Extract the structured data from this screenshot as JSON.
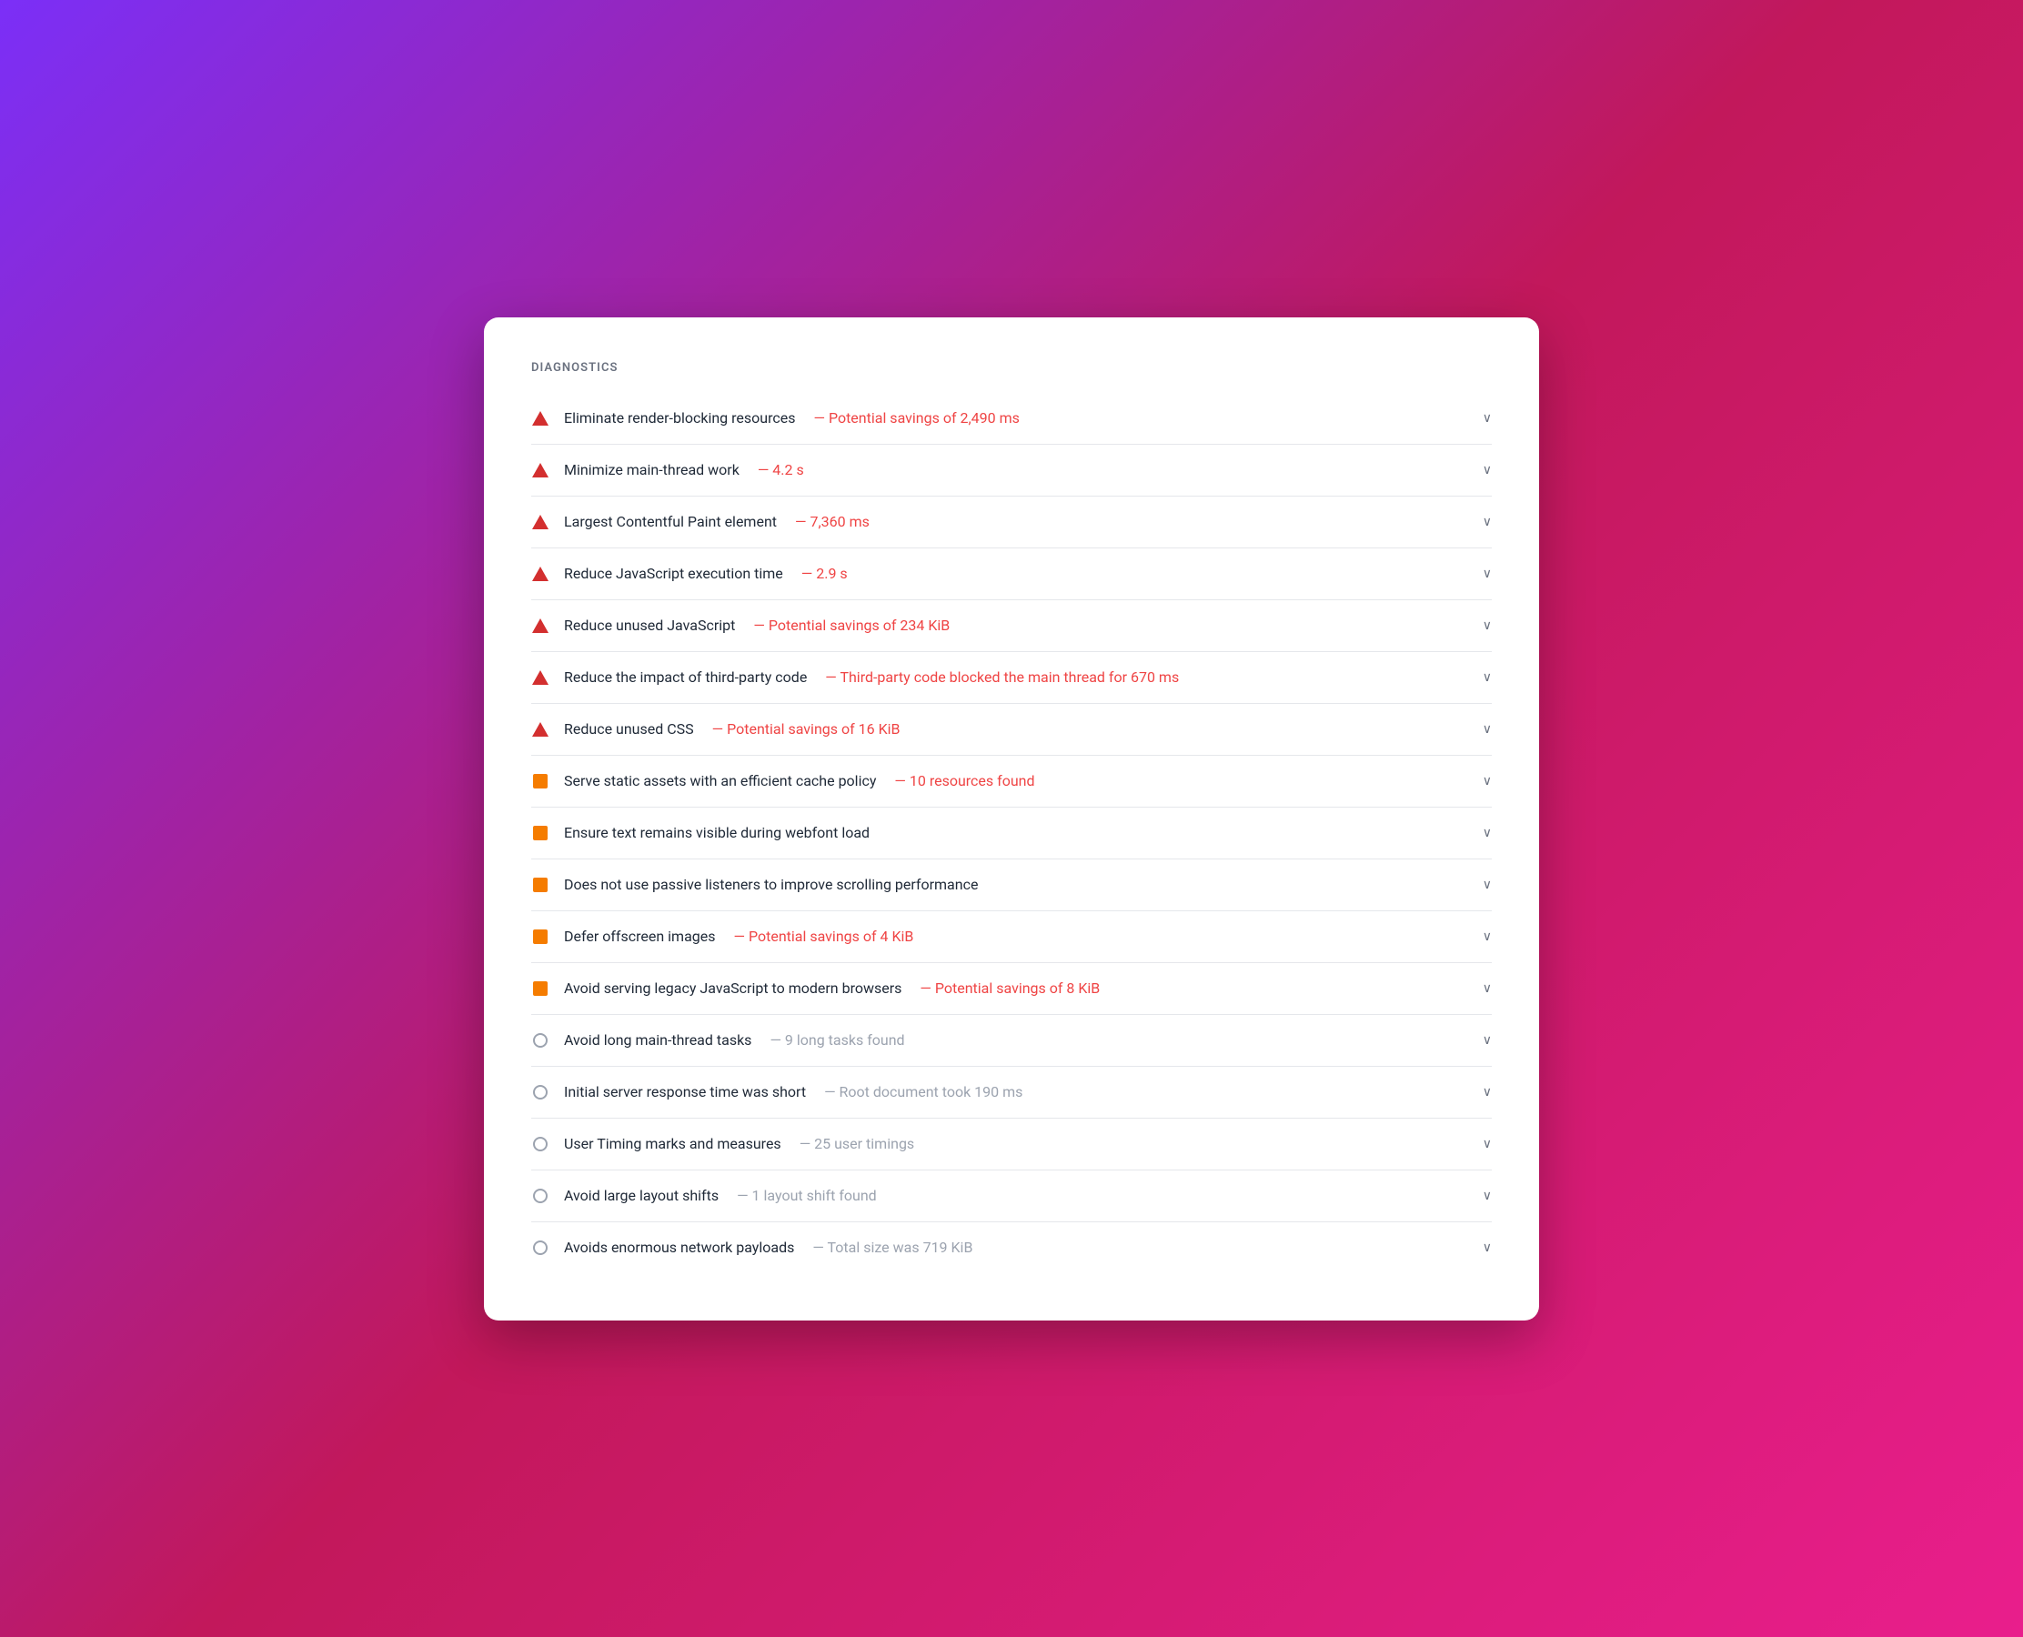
{
  "section": {
    "title": "DIAGNOSTICS"
  },
  "items": [
    {
      "id": "render-blocking",
      "icon": "triangle",
      "label": "Eliminate render-blocking resources",
      "detail": "— Potential savings of 2,490 ms",
      "detail_type": "red"
    },
    {
      "id": "main-thread-work",
      "icon": "triangle",
      "label": "Minimize main-thread work",
      "detail": "— 4.2 s",
      "detail_type": "red"
    },
    {
      "id": "lcp-element",
      "icon": "triangle",
      "label": "Largest Contentful Paint element",
      "detail": "— 7,360 ms",
      "detail_type": "red"
    },
    {
      "id": "js-execution-time",
      "icon": "triangle",
      "label": "Reduce JavaScript execution time",
      "detail": "— 2.9 s",
      "detail_type": "red"
    },
    {
      "id": "unused-js",
      "icon": "triangle",
      "label": "Reduce unused JavaScript",
      "detail": "— Potential savings of 234 KiB",
      "detail_type": "red"
    },
    {
      "id": "third-party-code",
      "icon": "triangle",
      "label": "Reduce the impact of third-party code",
      "detail": "— Third-party code blocked the main thread for 670 ms",
      "detail_type": "red"
    },
    {
      "id": "unused-css",
      "icon": "triangle",
      "label": "Reduce unused CSS",
      "detail": "— Potential savings of 16 KiB",
      "detail_type": "red"
    },
    {
      "id": "cache-policy",
      "icon": "square",
      "label": "Serve static assets with an efficient cache policy",
      "detail": "— 10 resources found",
      "detail_type": "red"
    },
    {
      "id": "webfont-load",
      "icon": "square",
      "label": "Ensure text remains visible during webfont load",
      "detail": "",
      "detail_type": "none"
    },
    {
      "id": "passive-listeners",
      "icon": "square",
      "label": "Does not use passive listeners to improve scrolling performance",
      "detail": "",
      "detail_type": "none"
    },
    {
      "id": "offscreen-images",
      "icon": "square",
      "label": "Defer offscreen images",
      "detail": "— Potential savings of 4 KiB",
      "detail_type": "red"
    },
    {
      "id": "legacy-js",
      "icon": "square",
      "label": "Avoid serving legacy JavaScript to modern browsers",
      "detail": "— Potential savings of 8 KiB",
      "detail_type": "red"
    },
    {
      "id": "long-tasks",
      "icon": "circle",
      "label": "Avoid long main-thread tasks",
      "detail": "— 9 long tasks found",
      "detail_type": "gray"
    },
    {
      "id": "server-response",
      "icon": "circle",
      "label": "Initial server response time was short",
      "detail": "— Root document took 190 ms",
      "detail_type": "gray"
    },
    {
      "id": "user-timing",
      "icon": "circle",
      "label": "User Timing marks and measures",
      "detail": "— 25 user timings",
      "detail_type": "gray"
    },
    {
      "id": "layout-shifts",
      "icon": "circle",
      "label": "Avoid large layout shifts",
      "detail": "— 1 layout shift found",
      "detail_type": "gray"
    },
    {
      "id": "network-payloads",
      "icon": "circle",
      "label": "Avoids enormous network payloads",
      "detail": "— Total size was 719 KiB",
      "detail_type": "gray"
    }
  ]
}
